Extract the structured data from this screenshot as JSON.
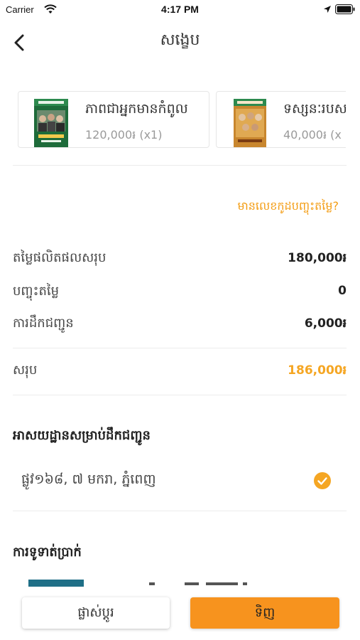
{
  "status_bar": {
    "carrier": "Carrier",
    "time": "4:17 PM",
    "icons": [
      "wifi-icon",
      "location-arrow-icon",
      "battery-icon"
    ]
  },
  "nav": {
    "back_icon": "chevron-left-icon",
    "title": "សង្ខេប"
  },
  "products": [
    {
      "name": "ភាពជាអ្នកមានកំពូល",
      "price": "120,000៛ (x1)"
    },
    {
      "name": "ទស្សនៈរបស",
      "price": "40,000៛ (x"
    }
  ],
  "promo": {
    "label": "មានលេខកូដបញ្ចុះតម្លៃ?"
  },
  "summary": {
    "subtotal": {
      "label": "តម្លៃផលិតផលសរុប",
      "value": "180,000៛"
    },
    "discount": {
      "label": "បញ្ចុះតម្លៃ",
      "value": "0"
    },
    "shipping": {
      "label": "ការដឹកជញ្ជូន",
      "value": "6,000៛"
    },
    "total": {
      "label": "សរុប",
      "value": "186,000៛"
    }
  },
  "delivery": {
    "section_title": "អាសយដ្ឋានសម្រាប់ដឹកជញ្ជូន",
    "address": "ផ្លូវ១៦៨, ៧ មករា, ភ្នំពេញ",
    "selected_icon": "check-circle-icon"
  },
  "payment": {
    "section_title": "ការទូទាត់ប្រាក់"
  },
  "buttons": {
    "change": "ផ្លាស់ប្តូរ",
    "buy": "ទិញ"
  },
  "colors": {
    "accent": "#f5a623",
    "buy_button": "#f7931e",
    "divider": "#ececec"
  }
}
